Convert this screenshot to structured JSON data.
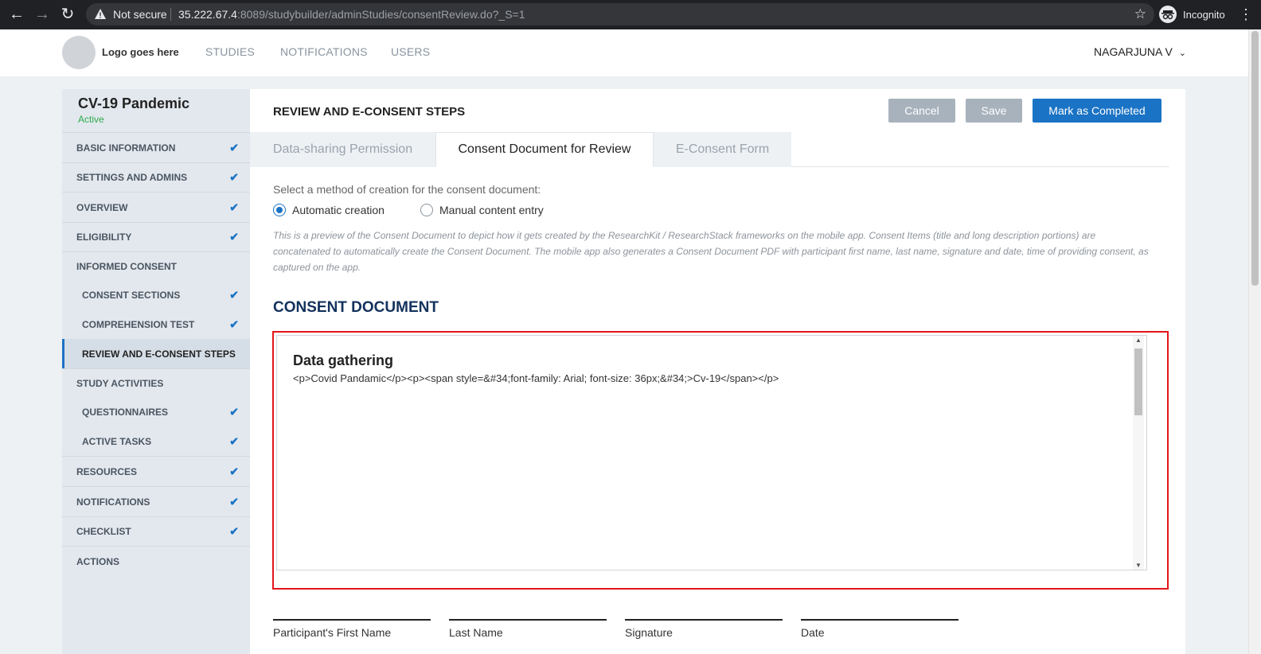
{
  "browser": {
    "security_text": "Not secure",
    "url_host": "35.222.67.4",
    "url_path": ":8089/studybuilder/adminStudies/consentReview.do?_S=1",
    "profile": "Incognito"
  },
  "header": {
    "logo_text": "Logo goes here",
    "nav": [
      "STUDIES",
      "NOTIFICATIONS",
      "USERS"
    ],
    "user": "NAGARJUNA V"
  },
  "sidebar": {
    "study_title": "CV-19 Pandemic",
    "study_status": "Active",
    "items": [
      {
        "label": "BASIC INFORMATION",
        "checked": true
      },
      {
        "label": "SETTINGS AND ADMINS",
        "checked": true
      },
      {
        "label": "OVERVIEW",
        "checked": true
      },
      {
        "label": "ELIGIBILITY",
        "checked": true
      },
      {
        "label": "INFORMED CONSENT",
        "checked": false
      },
      {
        "label": "CONSENT SECTIONS",
        "checked": true
      },
      {
        "label": "COMPREHENSION TEST",
        "checked": true
      },
      {
        "label": "REVIEW AND E-CONSENT STEPS",
        "checked": false
      },
      {
        "label": "STUDY ACTIVITIES",
        "checked": false
      },
      {
        "label": "QUESTIONNAIRES",
        "checked": true
      },
      {
        "label": "ACTIVE TASKS",
        "checked": true
      },
      {
        "label": "RESOURCES",
        "checked": true
      },
      {
        "label": "NOTIFICATIONS",
        "checked": true
      },
      {
        "label": "CHECKLIST",
        "checked": true
      },
      {
        "label": "ACTIONS",
        "checked": false
      }
    ]
  },
  "main": {
    "title": "REVIEW AND E-CONSENT STEPS",
    "buttons": {
      "cancel": "Cancel",
      "save": "Save",
      "complete": "Mark as Completed"
    },
    "tabs": [
      "Data-sharing Permission",
      "Consent Document for Review",
      "E-Consent Form"
    ],
    "active_tab": "Consent Document for Review",
    "method_label": "Select a method of creation for the consent document:",
    "methods": [
      "Automatic creation",
      "Manual content entry"
    ],
    "selected_method": "Automatic creation",
    "note": "This is a preview of the Consent Document to depict how it gets created by the ResearchKit / ResearchStack frameworks on the mobile app. Consent Items (title and long description portions) are concatenated to automatically create the Consent Document. The mobile app also generates a Consent Document PDF with participant first name, last name, signature and date, time of providing consent, as captured on the app.",
    "doc_heading": "CONSENT DOCUMENT",
    "doc_title": "Data gathering",
    "doc_body": "<p>Covid Pandamic</p><p><span style=&#34;font-family: Arial; font-size: 36px;&#34;>Cv-19</span></p>",
    "signature_fields": [
      "Participant's First Name",
      "Last Name",
      "Signature",
      "Date"
    ]
  },
  "colors": {
    "accent": "#1a73c4",
    "highlight_border": "#e3151a",
    "active_status": "#2eaa4f"
  }
}
